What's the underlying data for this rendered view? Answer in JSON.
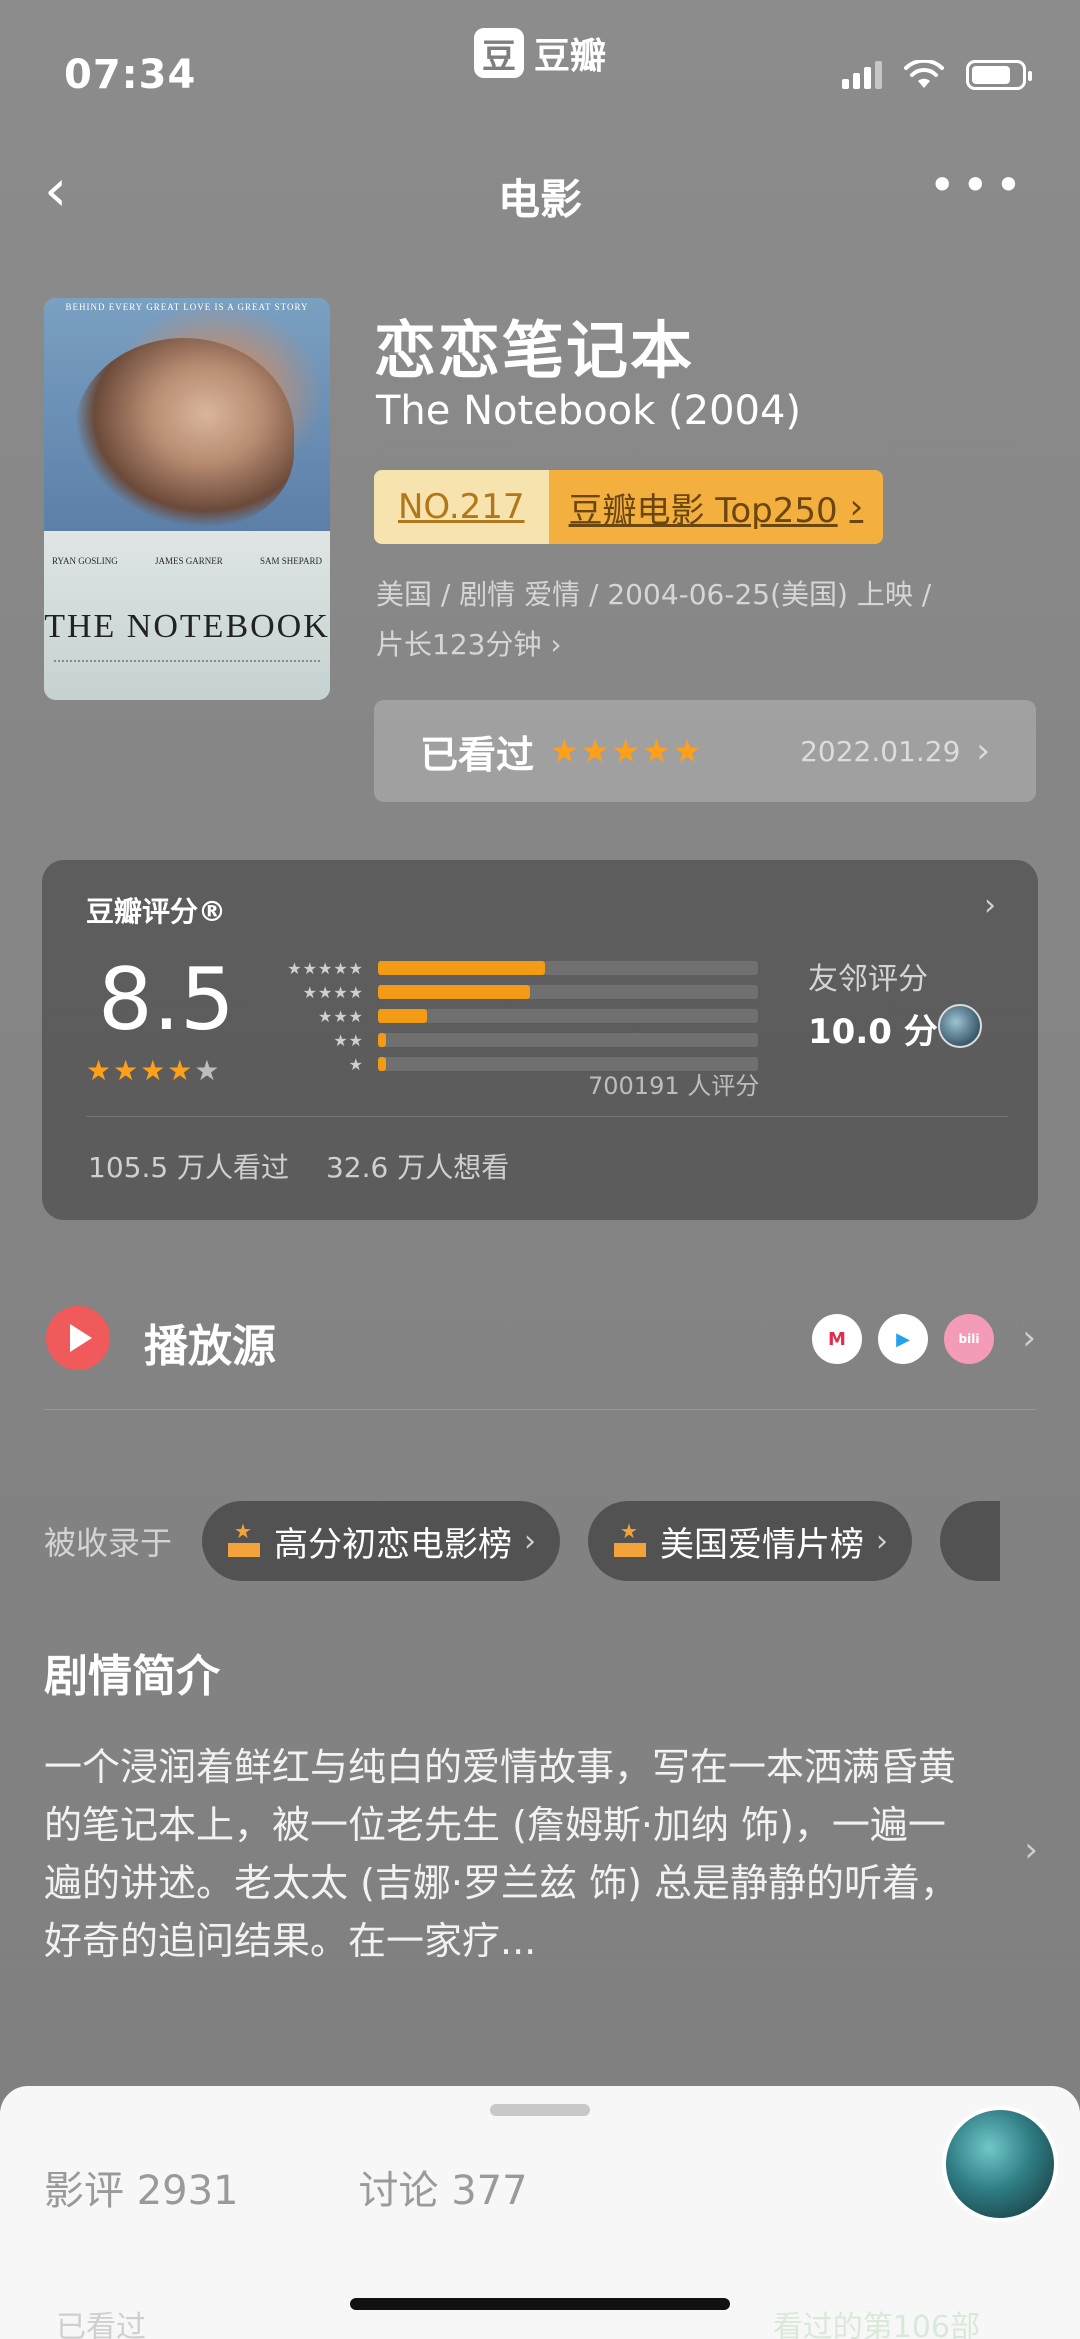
{
  "status": {
    "time": "07:34",
    "app_brand_icon": "豆",
    "app_brand": "豆瓣"
  },
  "nav": {
    "title": "电影"
  },
  "movie": {
    "title_cn": "恋恋笔记本",
    "title_en": "The Notebook (2004)",
    "rank_no": "NO.217",
    "rank_list": "豆瓣电影 Top250",
    "meta_line1": "美国 / 剧情 爱情 / 2004-06-25(美国) 上映 /",
    "meta_line2": "片长123分钟 ›",
    "poster": {
      "tagline": "BEHIND EVERY GREAT LOVE IS A GREAT STORY",
      "title": "THE NOTEBOOK",
      "credit1": "RYAN GOSLING",
      "credit2": "JAMES GARNER",
      "credit3": "SAM SHEPARD"
    }
  },
  "watched": {
    "label": "已看过",
    "stars": "★★★★★",
    "date": "2022.01.29"
  },
  "rating": {
    "title": "豆瓣评分®",
    "score": "8.5",
    "stars_full": "★★★★",
    "stars_empty": "★",
    "count": "700191 人评分",
    "friends_label": "友邻评分",
    "friends_score": "10.0 分",
    "watched_count": "105.5 万人看过",
    "wish_count": "32.6 万人想看",
    "distribution": [
      {
        "stars": "★★★★★",
        "percent": 44
      },
      {
        "stars": "★★★★",
        "percent": 40
      },
      {
        "stars": "★★★",
        "percent": 13
      },
      {
        "stars": "★★",
        "percent": 2
      },
      {
        "stars": "★",
        "percent": 2
      }
    ]
  },
  "play": {
    "label": "播放源",
    "platforms": [
      "M",
      "▶",
      "bili"
    ]
  },
  "collected": {
    "label": "被收录于",
    "chips": [
      "高分初恋电影榜",
      "美国爱情片榜"
    ]
  },
  "synopsis": {
    "title": "剧情简介",
    "text": "一个浸润着鲜红与纯白的爱情故事，写在一本洒满昏黄的笔记本上，被一位老先生 (詹姆斯·加纳 饰)，一遍一遍的讲述。老太太 (吉娜·罗兰兹 饰) 总是静静的听着，好奇的追问结果。在一家疗..."
  },
  "sheet": {
    "tab_reviews": "影评 2931",
    "tab_discussion": "讨论 377",
    "under_left": "已看过",
    "under_right": "看过的第106部"
  }
}
